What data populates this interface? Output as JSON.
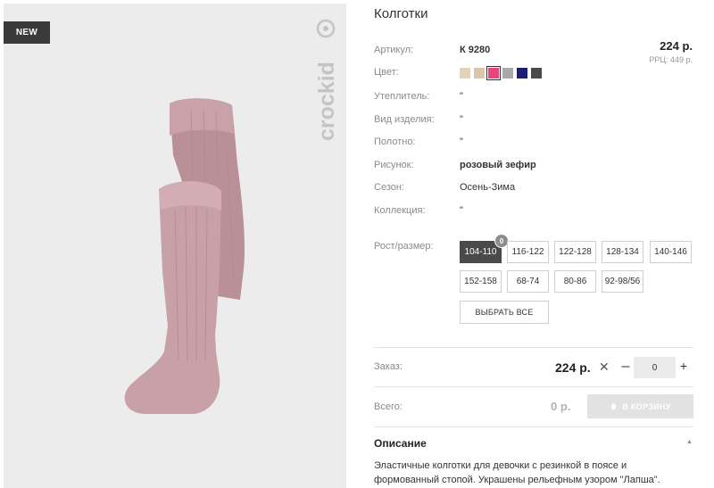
{
  "badge": {
    "new": "NEW"
  },
  "brand": {
    "logo_text": "crockid"
  },
  "product": {
    "title": "Колготки",
    "price": "224 р.",
    "rrp": "РРЦ: 449 р."
  },
  "attributes": [
    {
      "label": "Артикул:",
      "value": "К 9280"
    },
    {
      "label": "Цвет:",
      "value": ""
    },
    {
      "label": "Утеплитель:",
      "value": "\""
    },
    {
      "label": "Вид изделия:",
      "value": "\""
    },
    {
      "label": "Полотно:",
      "value": "\""
    },
    {
      "label": "Рисунок:",
      "value": "розовый зефир"
    },
    {
      "label": "Сезон:",
      "value": "Осень-Зима"
    },
    {
      "label": "Коллекция:",
      "value": "\""
    }
  ],
  "colors": {
    "swatches": [
      "#e3d3b8",
      "#d9c6a8",
      "#e8457f",
      "#a9a9a9",
      "#1c1f78",
      "#4a4a4a"
    ],
    "selected_index": 2
  },
  "sizes": {
    "label": "Рост/размер:",
    "options": [
      "104-110",
      "116-122",
      "122-128",
      "128-134",
      "140-146",
      "152-158",
      "68-74",
      "80-86",
      "92-98/56"
    ],
    "active_index": 0,
    "active_count": "0",
    "select_all": "ВЫБРАТЬ ВСЕ"
  },
  "order": {
    "label": "Заказ:",
    "price": "224 р.",
    "times": "✕",
    "minus": "–",
    "quantity": "0",
    "plus": "+"
  },
  "total": {
    "label": "Всего:",
    "value": "0 р.",
    "cart_button": "В КОРЗИНУ"
  },
  "description": {
    "title": "Описание",
    "text": "Эластичные колготки для девочки с резинкой в поясе и формованный стопой. Украшены рельефным узором \"Лапша\"."
  }
}
